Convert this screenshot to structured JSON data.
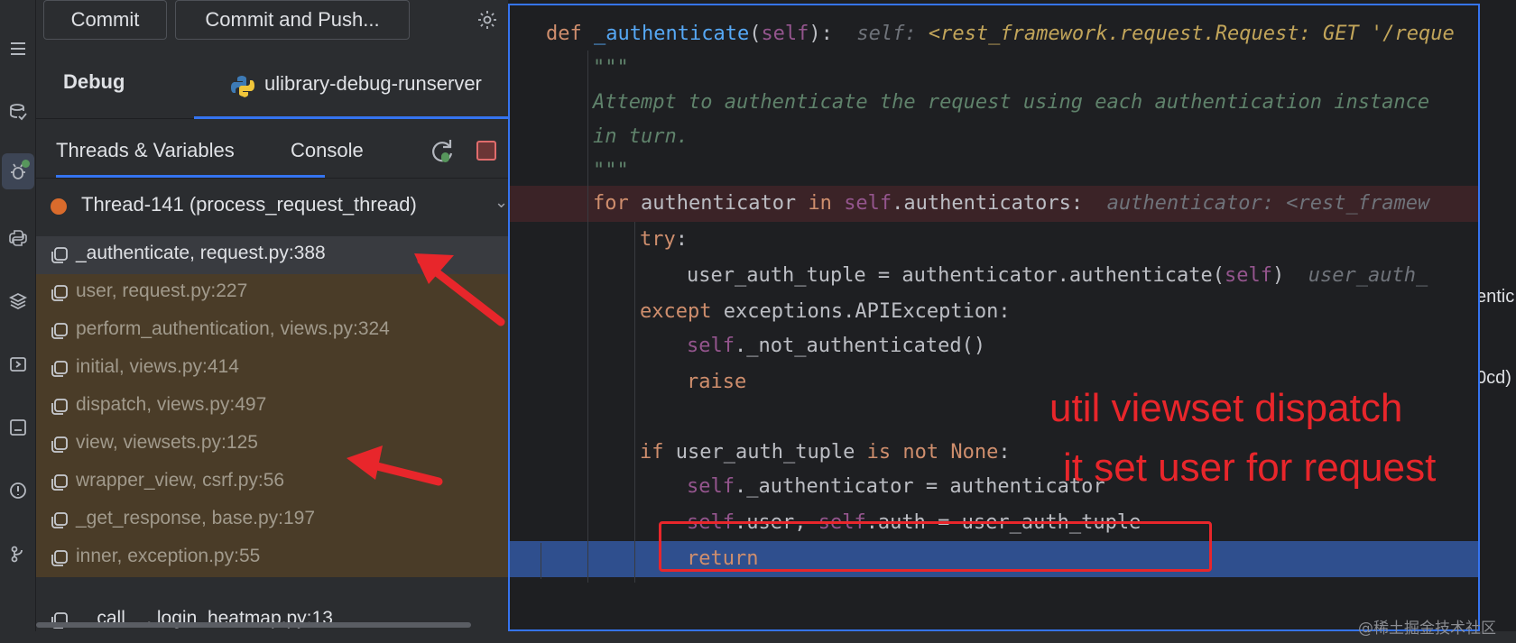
{
  "commit_bar": {
    "commit_label": "Commit",
    "commit_push_label": "Commit and Push..."
  },
  "debug": {
    "title": "Debug",
    "run_config": "ulibrary-debug-runserver",
    "tabs": [
      "Threads & Variables",
      "Console"
    ],
    "thread": "Thread-141 (process_request_thread)",
    "frames": [
      "_authenticate, request.py:388",
      "user, request.py:227",
      "perform_authentication, views.py:324",
      "initial, views.py:414",
      "dispatch, views.py:497",
      "view, viewsets.py:125",
      "wrapper_view, csrf.py:56",
      "_get_response, base.py:197",
      "inner, exception.py:55",
      "__call__, login_heatmap.py:13"
    ]
  },
  "code": {
    "def_kw": "def",
    "fn_name": "_authenticate",
    "def_params_open": "(",
    "def_self": "self",
    "def_params_close": "):",
    "def_hint_label": "self:",
    "def_hint_value": "<rest_framework.request.Request: GET '/reque",
    "doc_open": "\"\"\"",
    "doc_line1": "Attempt to authenticate the request using each authentication instance",
    "doc_line2": "in turn.",
    "doc_close": "\"\"\"",
    "for_kw": "for",
    "for_var": " authenticator ",
    "in_kw": "in",
    "for_self": "self",
    "for_rest": ".authenticators:",
    "for_hint": "authenticator: <rest_framew",
    "try_kw": "try",
    "try_colon": ":",
    "l_uat_assign": "user_auth_tuple = authenticator.authenticate(",
    "l_uat_self": "self",
    "l_uat_close": ")",
    "l_uat_hint": "user_auth_",
    "except_kw": "except",
    "except_rest": " exceptions.APIException:",
    "notauth_self": "self",
    "notauth_rest": "._not_authenticated()",
    "raise_kw": "raise",
    "if_kw": "if",
    "if_mid": " user_auth_tuple ",
    "is_not_kw": "is not",
    "none_kw": "None",
    "if_colon": ":",
    "l_authr_self": "self",
    "l_authr_rest": "._authenticator = authenticator",
    "l_user_self1": "self",
    "l_user_mid": ".user, ",
    "l_user_self2": "self",
    "l_user_rest": ".auth = user_auth_tuple",
    "return_kw": "return",
    "top_fragment": "\"\"\""
  },
  "right_clip": {
    "ent": "entic",
    "cd": "0cd)"
  },
  "annotation": {
    "line1": "util viewset dispatch",
    "line2": "it set user for request"
  },
  "watermark": "@稀土掘金技术社区",
  "colors": {
    "annotation_red": "#e8262b",
    "accent_blue": "#3574f0",
    "breakpoint_line": "#3b2327",
    "current_line": "#2f4f8e"
  }
}
